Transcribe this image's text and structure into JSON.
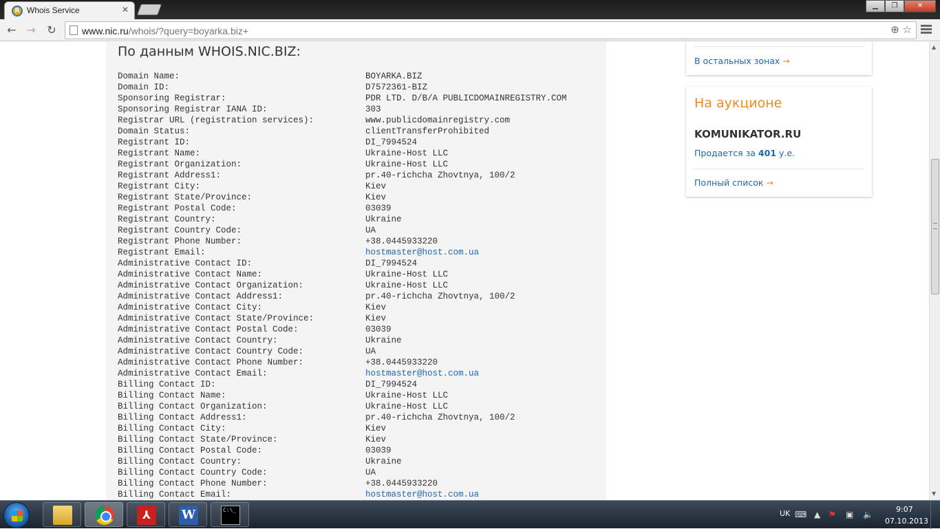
{
  "browser": {
    "tab_title": "Whois Service",
    "tab_favicon": "nic-logo-icon",
    "url_host": "www.nic.ru",
    "url_path": "/whois/?query=boyarka.biz+"
  },
  "whois": {
    "heading": "По данным WHOIS.NIC.BIZ:",
    "rows": [
      {
        "key": "Domain Name:",
        "value": "BOYARKA.BIZ"
      },
      {
        "key": "Domain ID:",
        "value": "D7572361-BIZ"
      },
      {
        "key": "Sponsoring Registrar:",
        "value": "PDR LTD. D/B/A PUBLICDOMAINREGISTRY.COM"
      },
      {
        "key": "Sponsoring Registrar IANA ID:",
        "value": "303"
      },
      {
        "key": "Registrar URL (registration services):",
        "value": "www.publicdomainregistry.com"
      },
      {
        "key": "Domain Status:",
        "value": "clientTransferProhibited"
      },
      {
        "key": "Registrant ID:",
        "value": "DI_7994524"
      },
      {
        "key": "Registrant Name:",
        "value": "Ukraine-Host LLC"
      },
      {
        "key": "Registrant Organization:",
        "value": "Ukraine-Host LLC"
      },
      {
        "key": "Registrant Address1:",
        "value": "pr.40-richcha Zhovtnya, 100/2"
      },
      {
        "key": "Registrant City:",
        "value": "Kiev"
      },
      {
        "key": "Registrant State/Province:",
        "value": "Kiev"
      },
      {
        "key": "Registrant Postal Code:",
        "value": "03039"
      },
      {
        "key": "Registrant Country:",
        "value": "Ukraine"
      },
      {
        "key": "Registrant Country Code:",
        "value": "UA"
      },
      {
        "key": "Registrant Phone Number:",
        "value": "+38.0445933220"
      },
      {
        "key": "Registrant Email:",
        "value": "hostmaster@host.com.ua",
        "link": true
      },
      {
        "key": "Administrative Contact ID:",
        "value": "DI_7994524"
      },
      {
        "key": "Administrative Contact Name:",
        "value": "Ukraine-Host LLC"
      },
      {
        "key": "Administrative Contact Organization:",
        "value": "Ukraine-Host LLC"
      },
      {
        "key": "Administrative Contact Address1:",
        "value": "pr.40-richcha Zhovtnya, 100/2"
      },
      {
        "key": "Administrative Contact City:",
        "value": "Kiev"
      },
      {
        "key": "Administrative Contact State/Province:",
        "value": "Kiev"
      },
      {
        "key": "Administrative Contact Postal Code:",
        "value": "03039"
      },
      {
        "key": "Administrative Contact Country:",
        "value": "Ukraine"
      },
      {
        "key": "Administrative Contact Country Code:",
        "value": "UA"
      },
      {
        "key": "Administrative Contact Phone Number:",
        "value": "+38.0445933220"
      },
      {
        "key": "Administrative Contact Email:",
        "value": "hostmaster@host.com.ua",
        "link": true
      },
      {
        "key": "Billing Contact ID:",
        "value": "DI_7994524"
      },
      {
        "key": "Billing Contact Name:",
        "value": "Ukraine-Host LLC"
      },
      {
        "key": "Billing Contact Organization:",
        "value": "Ukraine-Host LLC"
      },
      {
        "key": "Billing Contact Address1:",
        "value": "pr.40-richcha Zhovtnya, 100/2"
      },
      {
        "key": "Billing Contact City:",
        "value": "Kiev"
      },
      {
        "key": "Billing Contact State/Province:",
        "value": "Kiev"
      },
      {
        "key": "Billing Contact Postal Code:",
        "value": "03039"
      },
      {
        "key": "Billing Contact Country:",
        "value": "Ukraine"
      },
      {
        "key": "Billing Contact Country Code:",
        "value": "UA"
      },
      {
        "key": "Billing Contact Phone Number:",
        "value": "+38.0445933220"
      },
      {
        "key": "Billing Contact Email:",
        "value": "hostmaster@host.com.ua",
        "link": true
      }
    ]
  },
  "sidebar": {
    "other_zones_link": "В остальных зонах",
    "auction_title": "На аукционе",
    "auction_domain": "KOMUNIKATOR.RU",
    "auction_price_prefix": "Продается за",
    "auction_price_value": "401",
    "auction_price_suffix": "у.е.",
    "full_list_link": "Полный список",
    "arrow": "→"
  },
  "taskbar": {
    "language": "UK",
    "time": "9:07",
    "date": "07.10.2013",
    "cmd_label": "C:\\_"
  },
  "colors": {
    "link": "#1f66b0",
    "accent_orange": "#f08a1e",
    "panel_bg": "#f4f4f4"
  }
}
